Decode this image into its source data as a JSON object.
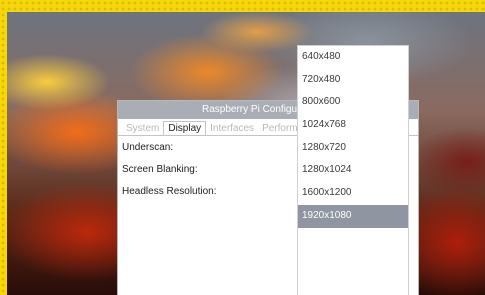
{
  "dialog": {
    "title": "Raspberry Pi Configuration",
    "tabs": [
      "System",
      "Display",
      "Interfaces",
      "Performance"
    ],
    "active_tab": "Display",
    "rows": [
      {
        "label": "Underscan:"
      },
      {
        "label": "Screen Blanking:"
      },
      {
        "label": "Headless Resolution:"
      }
    ]
  },
  "resolution_menu": {
    "options": [
      "640x480",
      "720x480",
      "800x600",
      "1024x768",
      "1280x720",
      "1280x1024",
      "1600x1200",
      "1920x1080"
    ],
    "selected": "1920x1080"
  },
  "colors": {
    "frame": "#f6d80a",
    "titlebar": "#a9adb5",
    "selection": "#8f96a1"
  }
}
